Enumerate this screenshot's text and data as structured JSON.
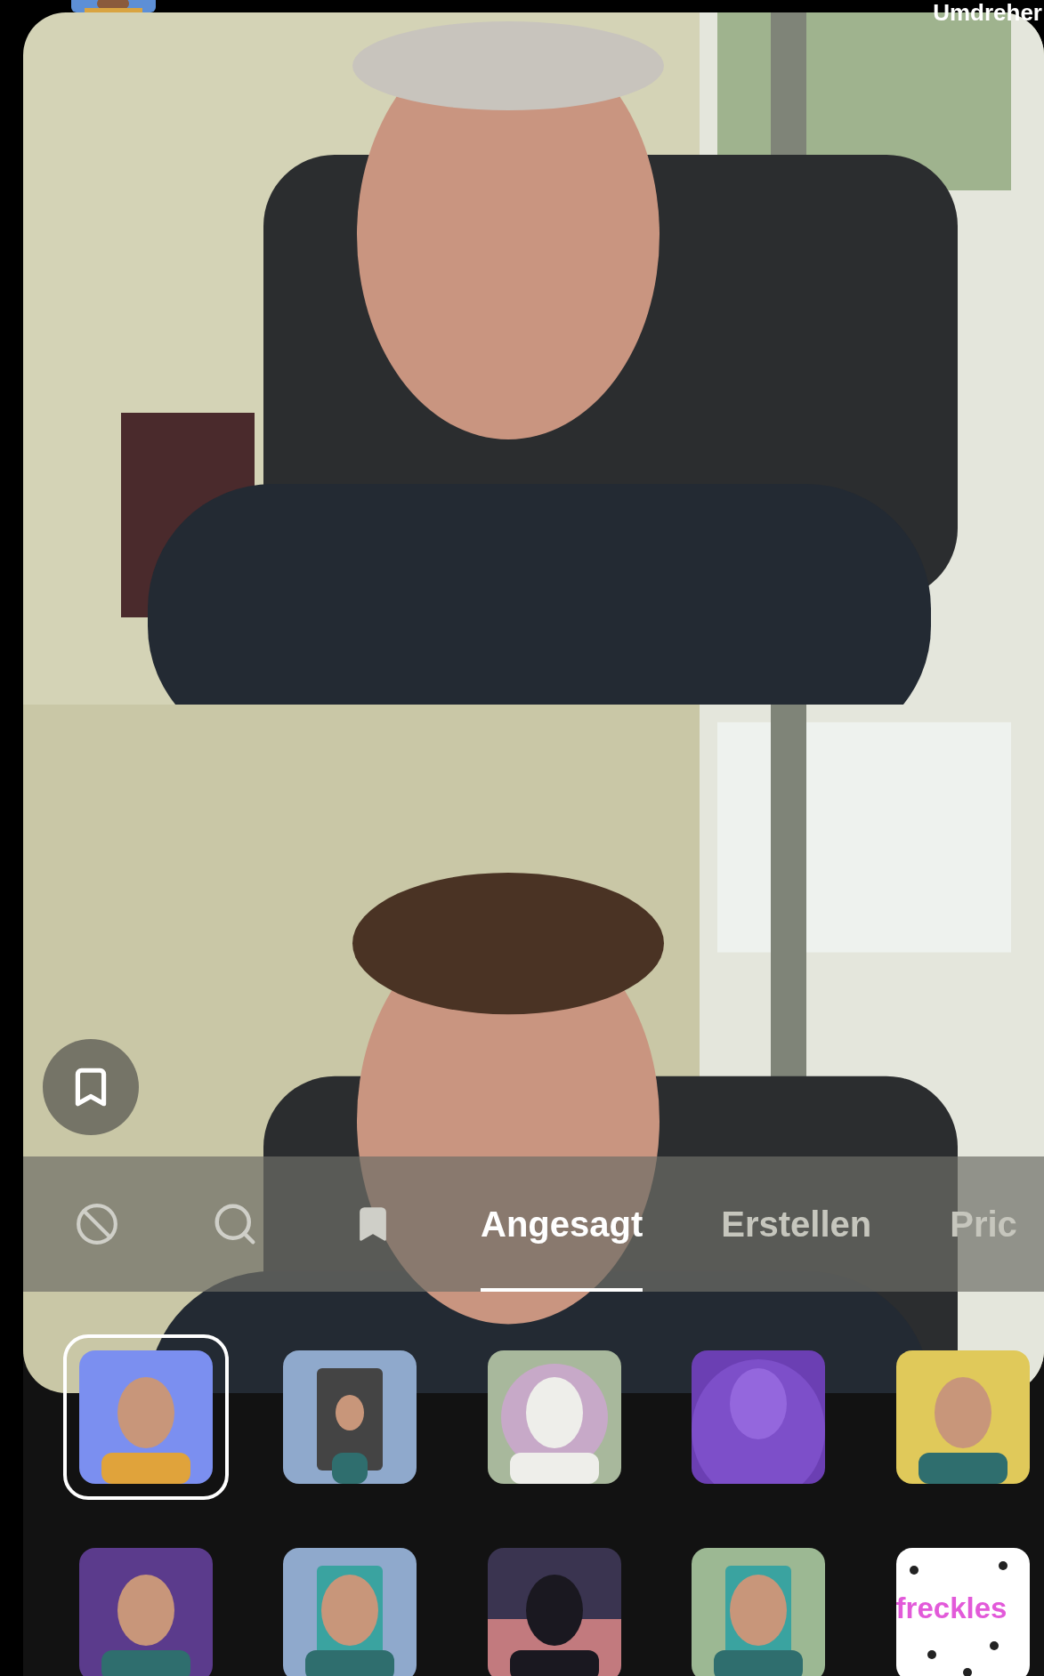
{
  "top_bar": {
    "flip_label": "Umdreher"
  },
  "tabs": [
    {
      "kind": "none",
      "selected": false
    },
    {
      "kind": "search",
      "selected": false
    },
    {
      "kind": "saved",
      "selected": false
    },
    {
      "kind": "text",
      "label": "Angesagt",
      "selected": true
    },
    {
      "kind": "text",
      "label": "Erstellen",
      "selected": false
    },
    {
      "kind": "text",
      "label": "Pric",
      "selected": false
    }
  ],
  "effects": [
    {
      "selected": true
    },
    {
      "selected": false
    },
    {
      "selected": false
    },
    {
      "selected": false
    },
    {
      "selected": false
    },
    {
      "selected": false
    },
    {
      "selected": false
    },
    {
      "selected": false
    },
    {
      "selected": false
    },
    {
      "selected": false,
      "label": "freckles"
    }
  ]
}
